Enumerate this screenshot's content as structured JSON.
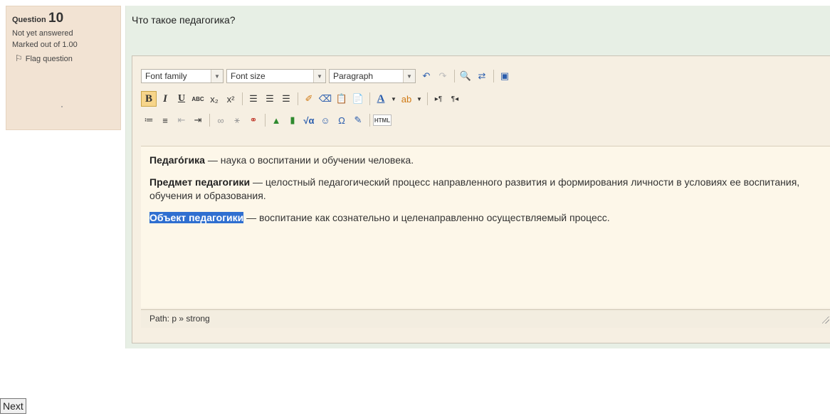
{
  "question_info": {
    "label": "Question",
    "number": "10",
    "state": "Not yet answered",
    "grade": "Marked out of 1.00",
    "flag_label": "Flag question"
  },
  "question": {
    "text": "Что такое педагогика?"
  },
  "toolbar": {
    "font_family": "Font family",
    "font_size": "Font size",
    "paragraph": "Paragraph",
    "bold_glyph": "B",
    "italic_glyph": "I",
    "underline_glyph": "U",
    "strike_glyph": "ABC",
    "sub_glyph": "x₂",
    "sup_glyph": "x²",
    "color_glyph": "A",
    "html_glyph": "HTML"
  },
  "editor": {
    "p1_strong": "Педаго́гика",
    "p1_rest": " — наука о воспитании и обучении человека.",
    "p2_strong": "Предмет педагогики",
    "p2_rest": " — целостный педагогический процесс направленного развития и формирования личности в условиях ее воспитания, обучения и образования.",
    "p3_strong": "Объект педагогики",
    "p3_rest": " — воспитание как сознательно и целенаправленно осуществляемый процесс.",
    "path": "Path: p » strong"
  },
  "nav": {
    "next_label": "Next"
  }
}
